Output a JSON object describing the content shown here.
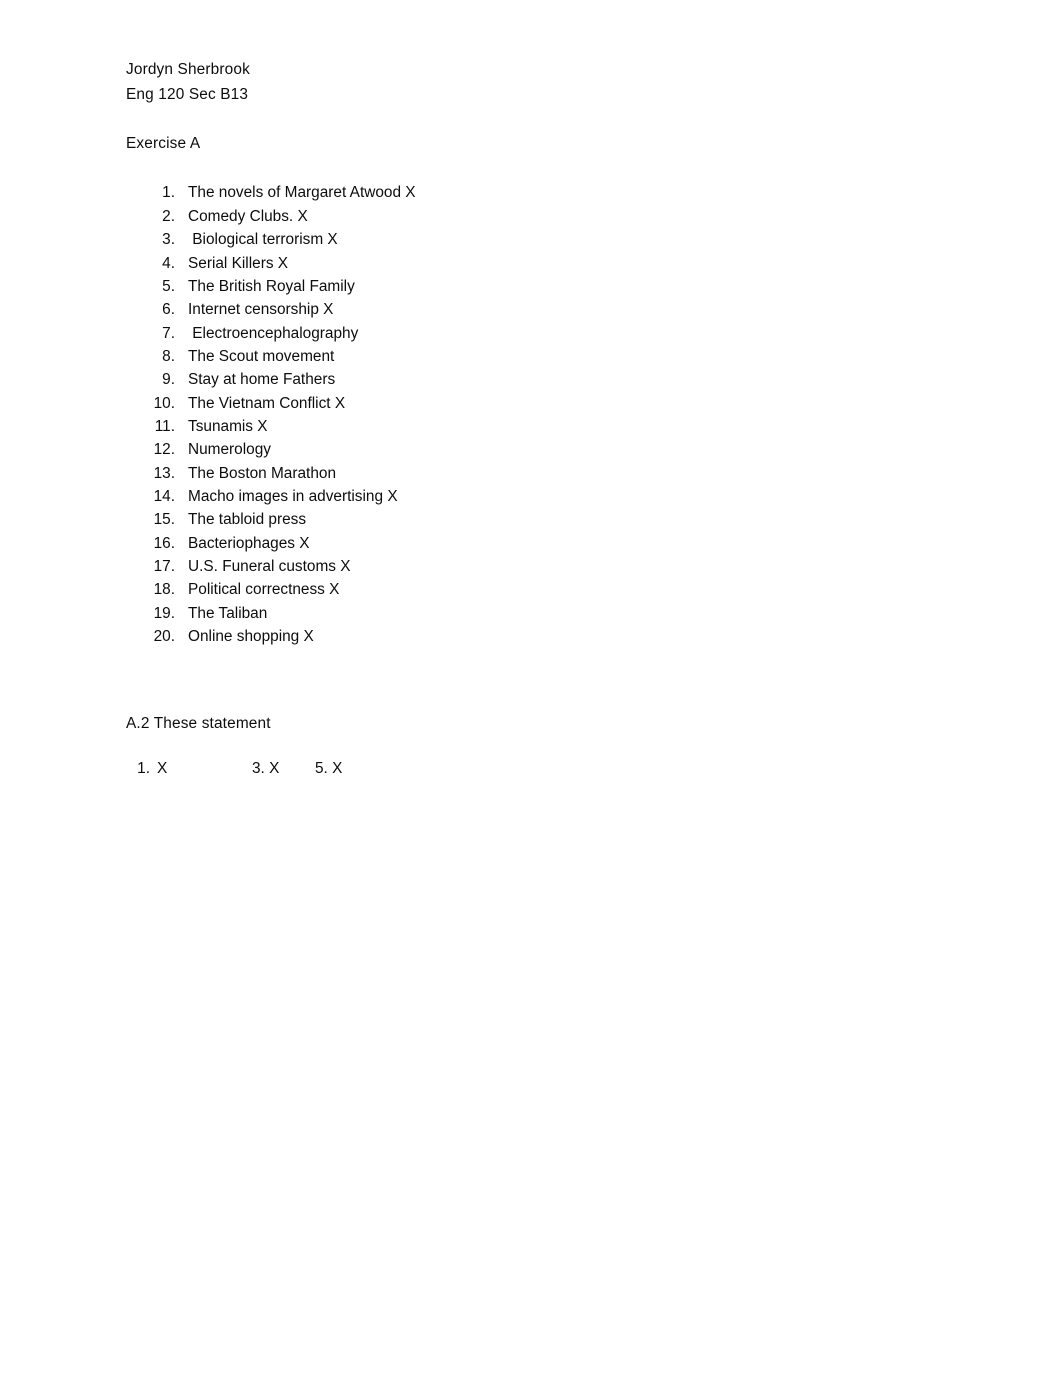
{
  "document": {
    "background_color": "#ffffff",
    "text_color": "#0d0d0d",
    "header": {
      "author_name": "Jordyn Sherbrook",
      "course_line": "Eng 120 Sec B13"
    },
    "exercise_a": {
      "title": "Exercise A",
      "items": [
        {
          "number": "1.",
          "text": "The novels of Margaret Atwood X"
        },
        {
          "number": "2.",
          "text": "Comedy Clubs. X"
        },
        {
          "number": "3.",
          "text": " Biological terrorism X"
        },
        {
          "number": "4.",
          "text": "Serial Killers X"
        },
        {
          "number": "5.",
          "text": "The British Royal Family"
        },
        {
          "number": "6.",
          "text": "Internet censorship X"
        },
        {
          "number": "7.",
          "text": " Electroencephalography"
        },
        {
          "number": "8.",
          "text": "The Scout movement"
        },
        {
          "number": "9.",
          "text": "Stay at home Fathers"
        },
        {
          "number": "10.",
          "text": "The Vietnam Conflict X"
        },
        {
          "number": "11.",
          "text": "Tsunamis X"
        },
        {
          "number": "12.",
          "text": "Numerology"
        },
        {
          "number": "13.",
          "text": "The Boston Marathon"
        },
        {
          "number": "14.",
          "text": "Macho images in advertising X"
        },
        {
          "number": "15.",
          "text": "The tabloid press"
        },
        {
          "number": "16.",
          "text": "Bacteriophages X"
        },
        {
          "number": "17.",
          "text": "U.S. Funeral customs X"
        },
        {
          "number": "18.",
          "text": "Political correctness X"
        },
        {
          "number": "19.",
          "text": "The Taliban"
        },
        {
          "number": "20.",
          "text": "Online shopping X"
        }
      ]
    },
    "exercise_a2": {
      "title": "A.2 These statement",
      "answer_row": {
        "number": "1.",
        "answer_1": "X",
        "answer_3": "3. X",
        "answer_5": "5. X"
      }
    }
  }
}
